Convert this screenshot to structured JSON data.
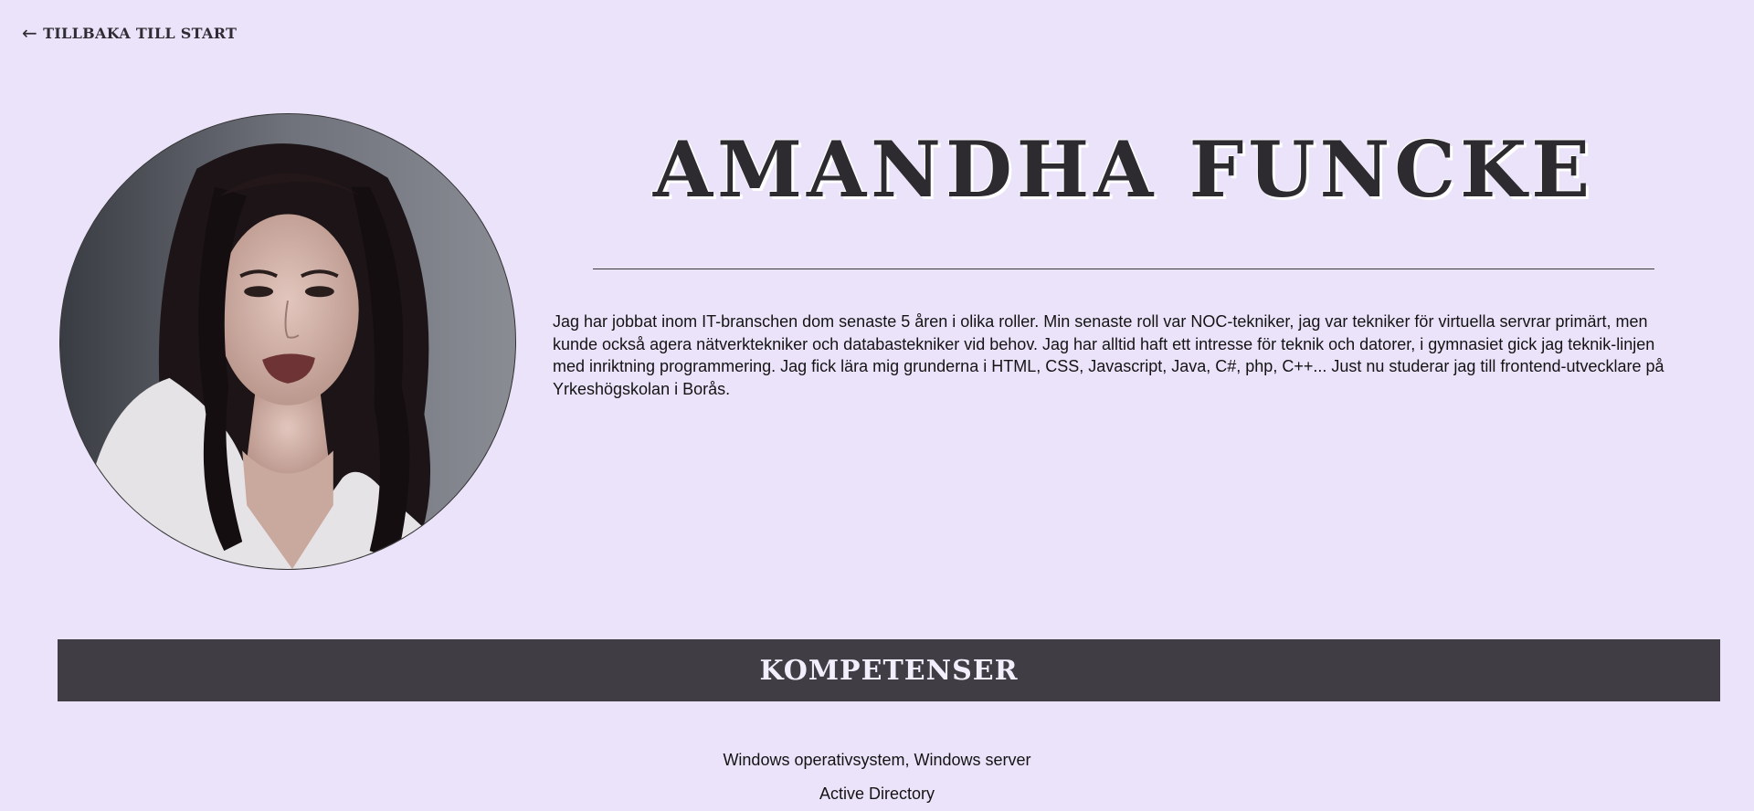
{
  "nav": {
    "back_arrow": "←",
    "back_label": "TILLBAKA TILL START"
  },
  "profile": {
    "name": "AMANDHA FUNCKE",
    "bio": "Jag har jobbat inom IT-branschen dom senaste 5 åren i olika roller. Min senaste roll var NOC-tekniker, jag var tekniker för virtuella servrar primärt, men kunde också agera nätverktekniker och databastekniker vid behov. Jag har alltid haft ett intresse för teknik och datorer, i gymnasiet gick jag teknik-linjen med inriktning programmering. Jag fick lära mig grunderna i HTML, CSS, Javascript, Java, C#, php, C++... Just nu studerar jag till frontend-utvecklare på Yrkeshögskolan i Borås.",
    "photo_icon": "portrait-photo"
  },
  "skills": {
    "heading": "KOMPETENSER",
    "items": [
      "Windows operativsystem, Windows server",
      "Active Directory"
    ]
  },
  "colors": {
    "background": "#ebe3fa",
    "bar": "#403d44",
    "heading_text": "#2d2b30"
  }
}
